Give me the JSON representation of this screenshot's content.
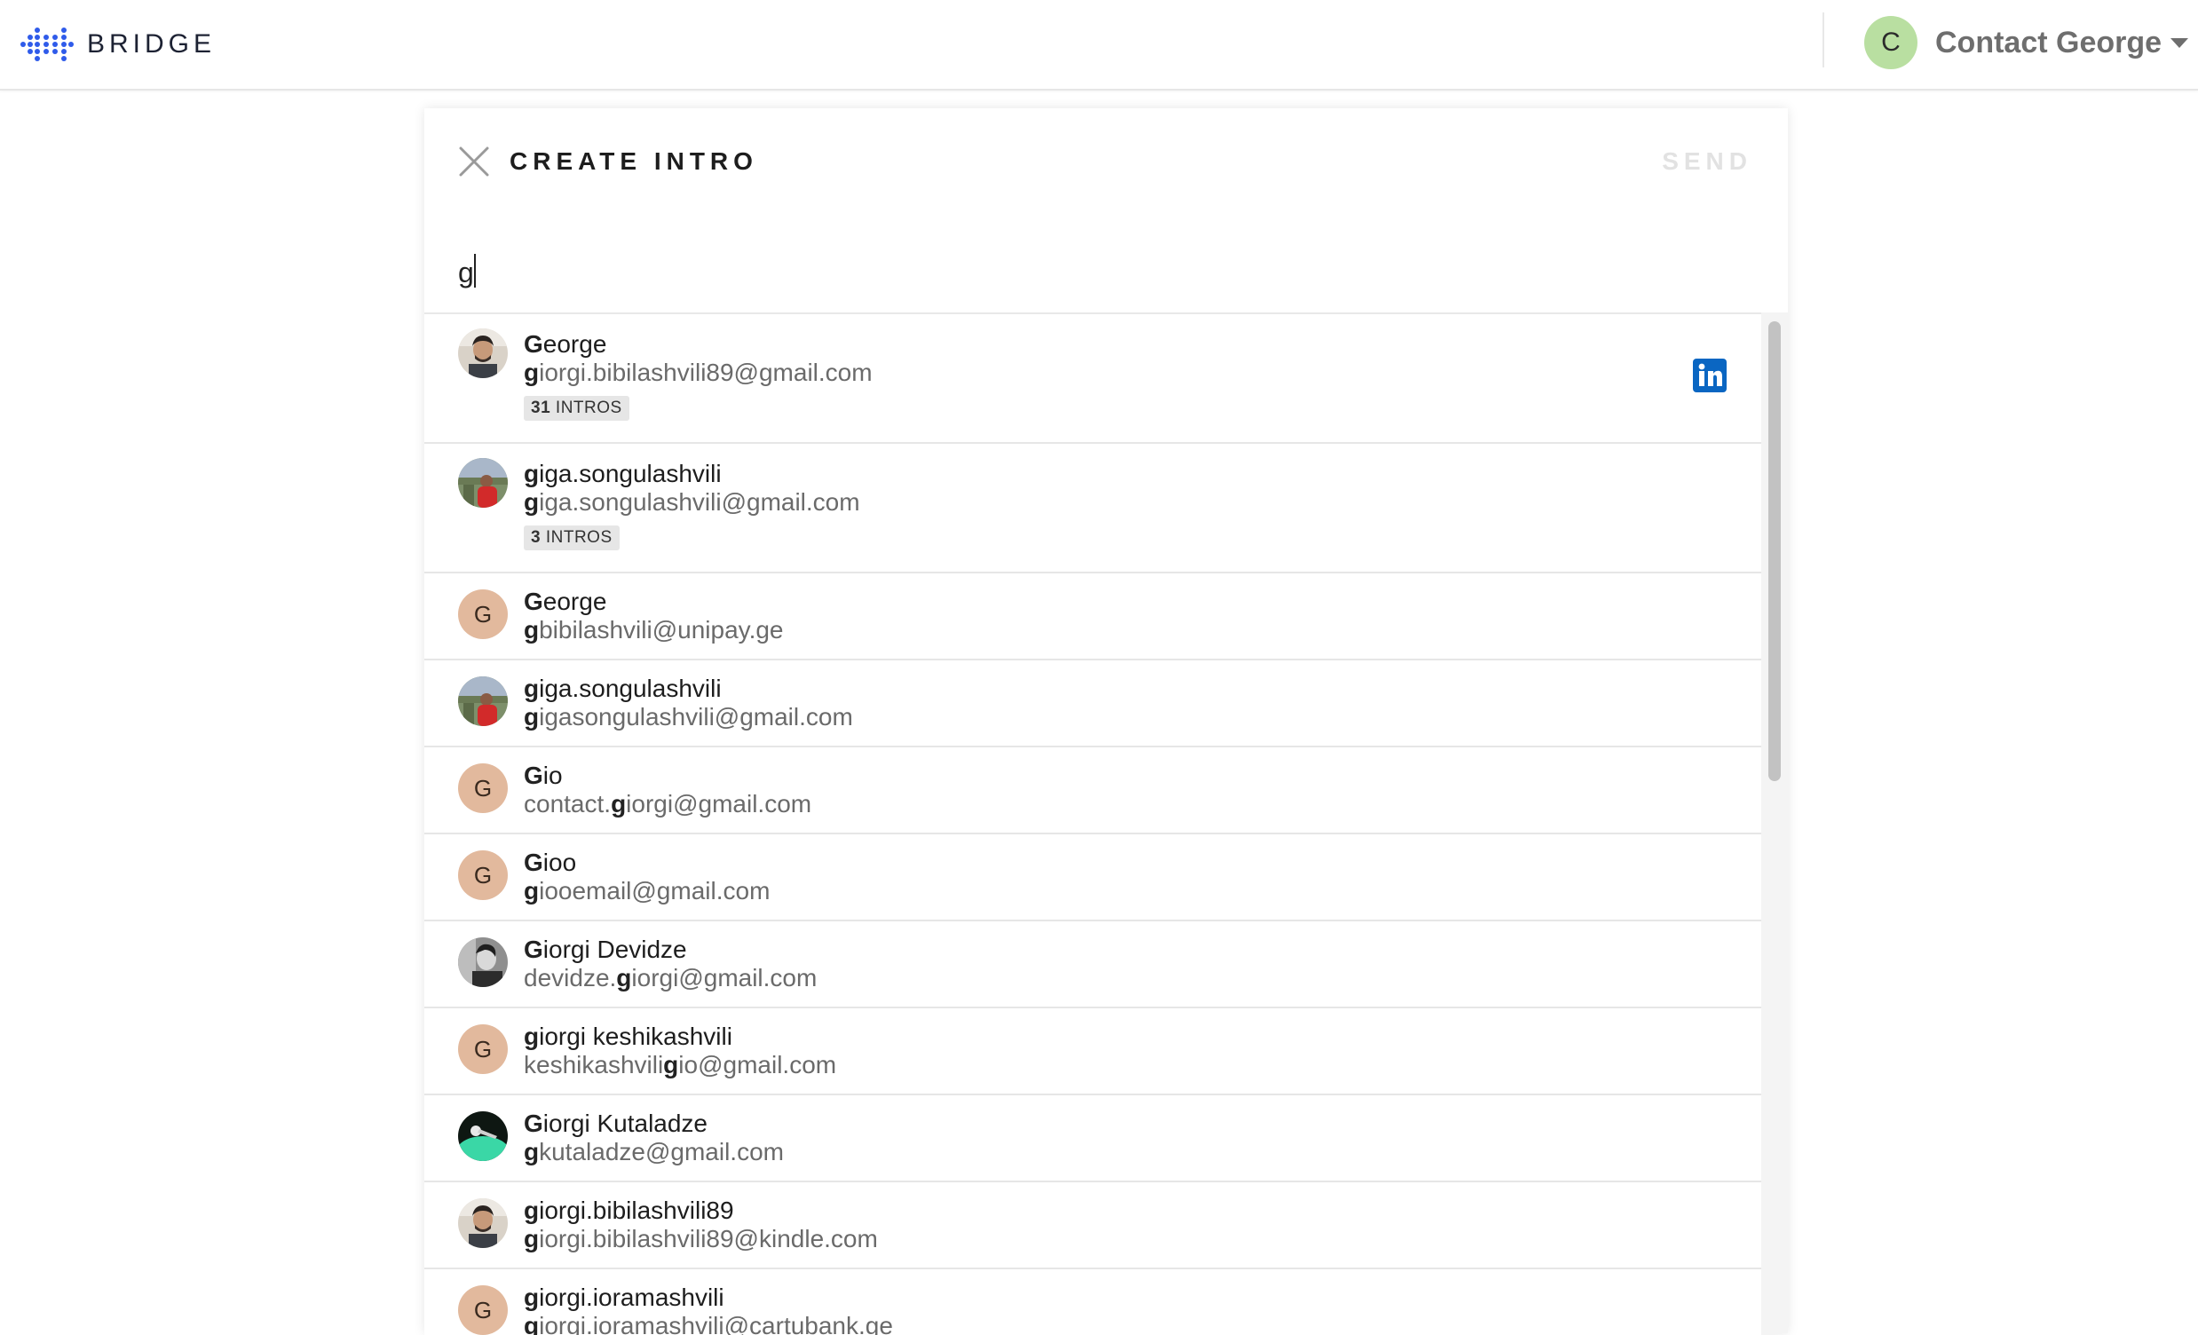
{
  "header": {
    "brand": "BRIDGE",
    "user_initial": "C",
    "user_name": "Contact George",
    "brand_color": "#2f5bea",
    "user_avatar_color": "#b9dfa1"
  },
  "modal": {
    "title": "CREATE INTRO",
    "send_label": "SEND",
    "close_icon": "close-icon"
  },
  "search": {
    "value": "g"
  },
  "results": [
    {
      "hl_name": "G",
      "rest_name": "eorge",
      "email_pre": "",
      "email_hl": "g",
      "email_post": "iorgi.bibilashvili89@gmail.com",
      "intros_count": "31",
      "intros_label": "INTROS",
      "avatar": "photo-man",
      "linkedin": true
    },
    {
      "hl_name": "g",
      "rest_name": "iga.songulashvili",
      "email_pre": "",
      "email_hl": "g",
      "email_post": "iga.songulashvili@gmail.com",
      "intros_count": "3",
      "intros_label": "INTROS",
      "avatar": "photo-red"
    },
    {
      "hl_name": "G",
      "rest_name": "eorge",
      "email_pre": "",
      "email_hl": "g",
      "email_post": "bibilashvili@unipay.ge",
      "letter": "G"
    },
    {
      "hl_name": "g",
      "rest_name": "iga.songulashvili",
      "email_pre": "",
      "email_hl": "g",
      "email_post": "igasongulashvili@gmail.com",
      "avatar": "photo-red"
    },
    {
      "hl_name": "G",
      "rest_name": "io",
      "email_pre": "contact.",
      "email_hl": "g",
      "email_post": "iorgi@gmail.com",
      "letter": "G"
    },
    {
      "hl_name": "G",
      "rest_name": "ioo",
      "email_pre": "",
      "email_hl": "g",
      "email_post": "iooemail@gmail.com",
      "letter": "G"
    },
    {
      "hl_name": "G",
      "rest_name": "iorgi Devidze",
      "email_pre": "devidze.",
      "email_hl": "g",
      "email_post": "iorgi@gmail.com",
      "avatar": "photo-bw"
    },
    {
      "hl_name": "g",
      "rest_name": "iorgi keshikashvili",
      "email_pre": "keshikashvili",
      "email_hl": "g",
      "email_post": "io@gmail.com",
      "letter": "G"
    },
    {
      "hl_name": "G",
      "rest_name": "iorgi Kutaladze",
      "email_pre": "",
      "email_hl": "g",
      "email_post": "kutaladze@gmail.com",
      "avatar": "photo-green"
    },
    {
      "hl_name": "g",
      "rest_name": "iorgi.bibilashvili89",
      "email_pre": "",
      "email_hl": "g",
      "email_post": "iorgi.bibilashvili89@kindle.com",
      "avatar": "photo-man"
    },
    {
      "hl_name": "g",
      "rest_name": "iorgi.ioramashvili",
      "email_pre": "",
      "email_hl": "g",
      "email_post": "iorgi.ioramashvili@cartubank.ge",
      "letter": "G"
    }
  ]
}
